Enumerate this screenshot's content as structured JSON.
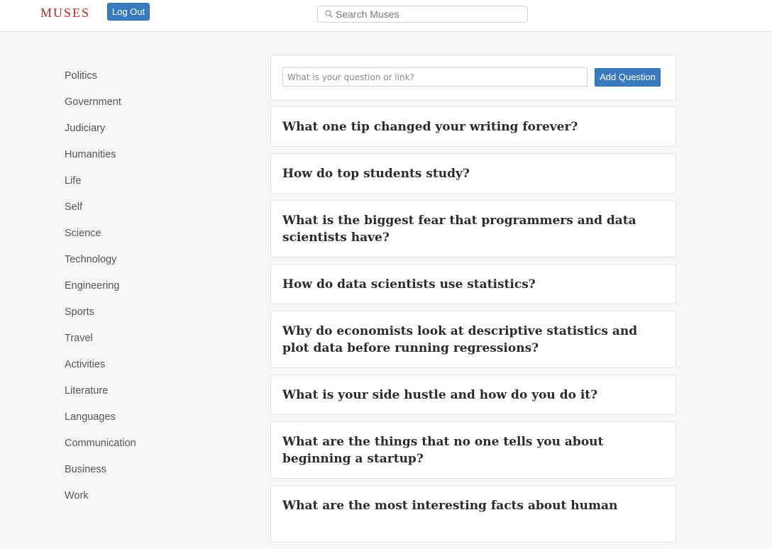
{
  "header": {
    "logo": "MUSES",
    "logout_label": "Log Out",
    "search_placeholder": "Search Muses"
  },
  "sidebar": {
    "items": [
      {
        "label": "Politics"
      },
      {
        "label": "Government"
      },
      {
        "label": "Judiciary"
      },
      {
        "label": "Humanities"
      },
      {
        "label": "Life"
      },
      {
        "label": "Self"
      },
      {
        "label": "Science"
      },
      {
        "label": "Technology"
      },
      {
        "label": "Engineering"
      },
      {
        "label": "Sports"
      },
      {
        "label": "Travel"
      },
      {
        "label": "Activities"
      },
      {
        "label": "Literature"
      },
      {
        "label": "Languages"
      },
      {
        "label": "Communication"
      },
      {
        "label": "Business"
      },
      {
        "label": "Work"
      }
    ]
  },
  "ask": {
    "placeholder": "What is your question or link?",
    "button_label": "Add Question"
  },
  "questions": [
    {
      "text": "What one tip changed your writing forever?"
    },
    {
      "text": "How do top students study?"
    },
    {
      "text": "What is the biggest fear that programmers and data scientists have?"
    },
    {
      "text": "How do data scientists use statistics?"
    },
    {
      "text": "Why do economists look at descriptive statistics and plot data before running regressions?"
    },
    {
      "text": "What is your side hustle and how do you do it?"
    },
    {
      "text": "What are the things that no one tells you about beginning a startup?"
    },
    {
      "text": "What are the most interesting facts about human"
    }
  ],
  "colors": {
    "brand": "#b92b27",
    "button": "#3a7bbf"
  }
}
